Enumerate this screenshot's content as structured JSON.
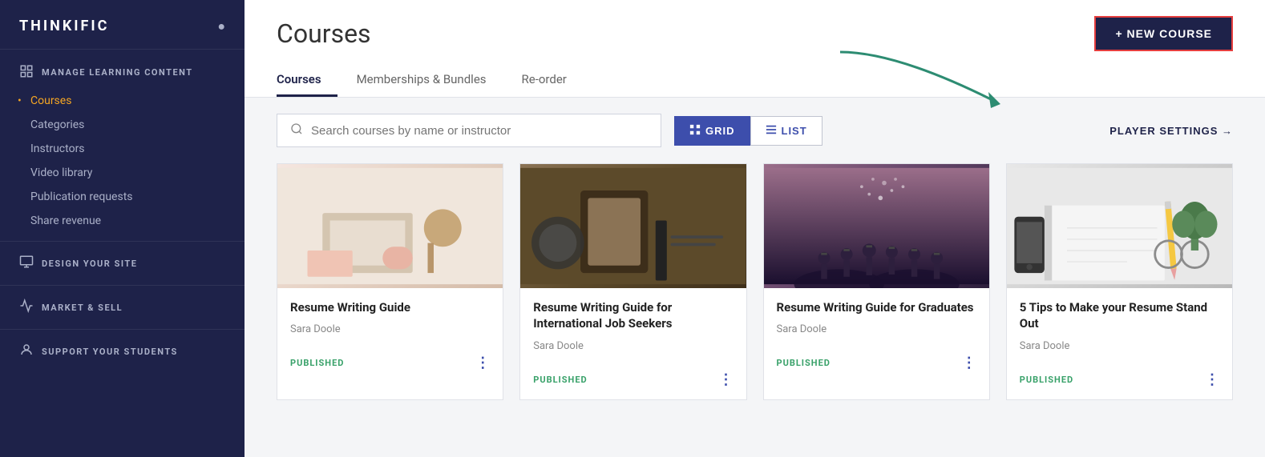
{
  "app": {
    "logo": "THINKIFIC"
  },
  "sidebar": {
    "sections": [
      {
        "id": "manage-learning",
        "icon": "📋",
        "label": "MANAGE LEARNING CONTENT",
        "nav_items": [
          {
            "label": "Courses",
            "active": true
          },
          {
            "label": "Categories",
            "active": false
          },
          {
            "label": "Instructors",
            "active": false
          },
          {
            "label": "Video library",
            "active": false
          },
          {
            "label": "Publication requests",
            "active": false
          },
          {
            "label": "Share revenue",
            "active": false
          }
        ]
      },
      {
        "id": "design-site",
        "icon": "🖥",
        "label": "DESIGN YOUR SITE",
        "nav_items": []
      },
      {
        "id": "market-sell",
        "icon": "📈",
        "label": "MARKET & SELL",
        "nav_items": []
      },
      {
        "id": "support-students",
        "icon": "👤",
        "label": "SUPPORT YOUR STUDENTS",
        "nav_items": []
      }
    ]
  },
  "main": {
    "page_title": "Courses",
    "tabs": [
      {
        "label": "Courses",
        "active": true
      },
      {
        "label": "Memberships & Bundles",
        "active": false
      },
      {
        "label": "Re-order",
        "active": false
      }
    ],
    "new_course_btn": "+ NEW COURSE",
    "search_placeholder": "Search courses by name or instructor",
    "view_buttons": [
      {
        "label": "GRID",
        "active": true
      },
      {
        "label": "LIST",
        "active": false
      }
    ],
    "player_settings": "PLAYER SETTINGS →",
    "courses": [
      {
        "title": "Resume Writing Guide",
        "author": "Sara Doole",
        "status": "PUBLISHED",
        "thumb_class": "thumb-1"
      },
      {
        "title": "Resume Writing Guide for International Job Seekers",
        "author": "Sara Doole",
        "status": "PUBLISHED",
        "thumb_class": "thumb-2"
      },
      {
        "title": "Resume Writing Guide for Graduates",
        "author": "Sara Doole",
        "status": "PUBLISHED",
        "thumb_class": "thumb-3"
      },
      {
        "title": "5 Tips to Make your Resume Stand Out",
        "author": "Sara Doole",
        "status": "PUBLISHED",
        "thumb_class": "thumb-4"
      }
    ]
  }
}
